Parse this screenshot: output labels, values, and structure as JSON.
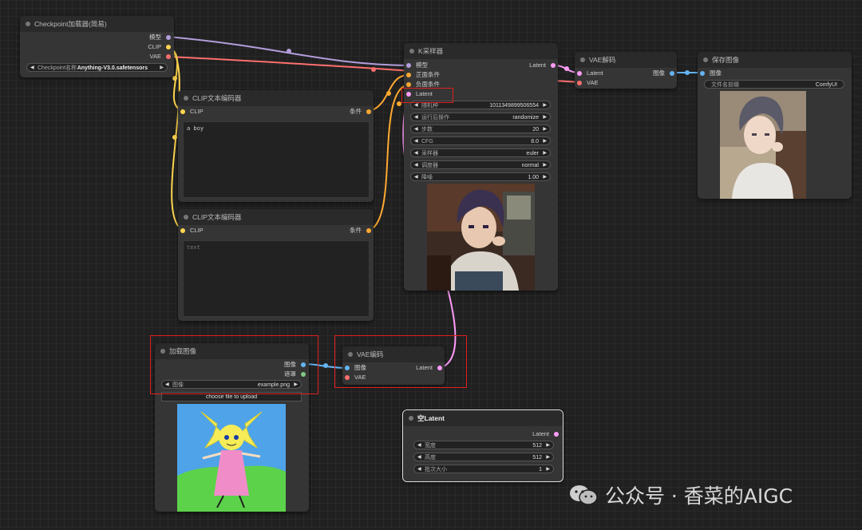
{
  "colors": {
    "model": "#b39ddb",
    "clip": "#ffd54f",
    "vae": "#ff6e6e",
    "latent": "#ff9cf9",
    "image": "#64b5f6",
    "conditioning": "#ffa931",
    "mask": "#81c784",
    "highlight": "#e02020"
  },
  "checkpoint_loader": {
    "title": "Checkpoint加载器(简易)",
    "outputs": [
      "模型",
      "CLIP",
      "VAE"
    ],
    "widget_label": "Checkpoint名称",
    "widget_value": "Anything-V3.0.safetensors"
  },
  "clip_encoder_1": {
    "title": "CLIP文本编码器",
    "input": "CLIP",
    "output": "条件",
    "text": "a boy"
  },
  "clip_encoder_2": {
    "title": "CLIP文本编码器",
    "input": "CLIP",
    "output": "条件",
    "text": "text"
  },
  "ksampler": {
    "title": "K采样器",
    "inputs": [
      "模型",
      "正面条件",
      "负面条件",
      "Latent"
    ],
    "output": "Latent",
    "widgets": [
      {
        "label": "随机种",
        "value": "1011349899506554"
      },
      {
        "label": "运行后操作",
        "value": "randomize"
      },
      {
        "label": "步数",
        "value": "20"
      },
      {
        "label": "CFG",
        "value": "8.0"
      },
      {
        "label": "采样器",
        "value": "euler"
      },
      {
        "label": "调度器",
        "value": "normal"
      },
      {
        "label": "降噪",
        "value": "1.00"
      }
    ]
  },
  "vae_decode": {
    "title": "VAE解码",
    "inputs": [
      "Latent",
      "VAE"
    ],
    "output": "图像"
  },
  "save_image": {
    "title": "保存图像",
    "input": "图像",
    "widget_label": "文件名前缀",
    "widget_value": "ComfyUI"
  },
  "load_image": {
    "title": "加载图像",
    "outputs": [
      "图像",
      "遮罩"
    ],
    "widget_label": "图像",
    "widget_value": "example.png",
    "upload_label": "choose file to upload"
  },
  "vae_encode": {
    "title": "VAE编码",
    "inputs": [
      "图像",
      "VAE"
    ],
    "output": "Latent"
  },
  "empty_latent": {
    "title": "空Latent",
    "output": "Latent",
    "widgets": [
      {
        "label": "宽度",
        "value": "512"
      },
      {
        "label": "高度",
        "value": "512"
      },
      {
        "label": "批次大小",
        "value": "1"
      }
    ]
  },
  "watermark": "公众号 · 香菜的AIGC"
}
